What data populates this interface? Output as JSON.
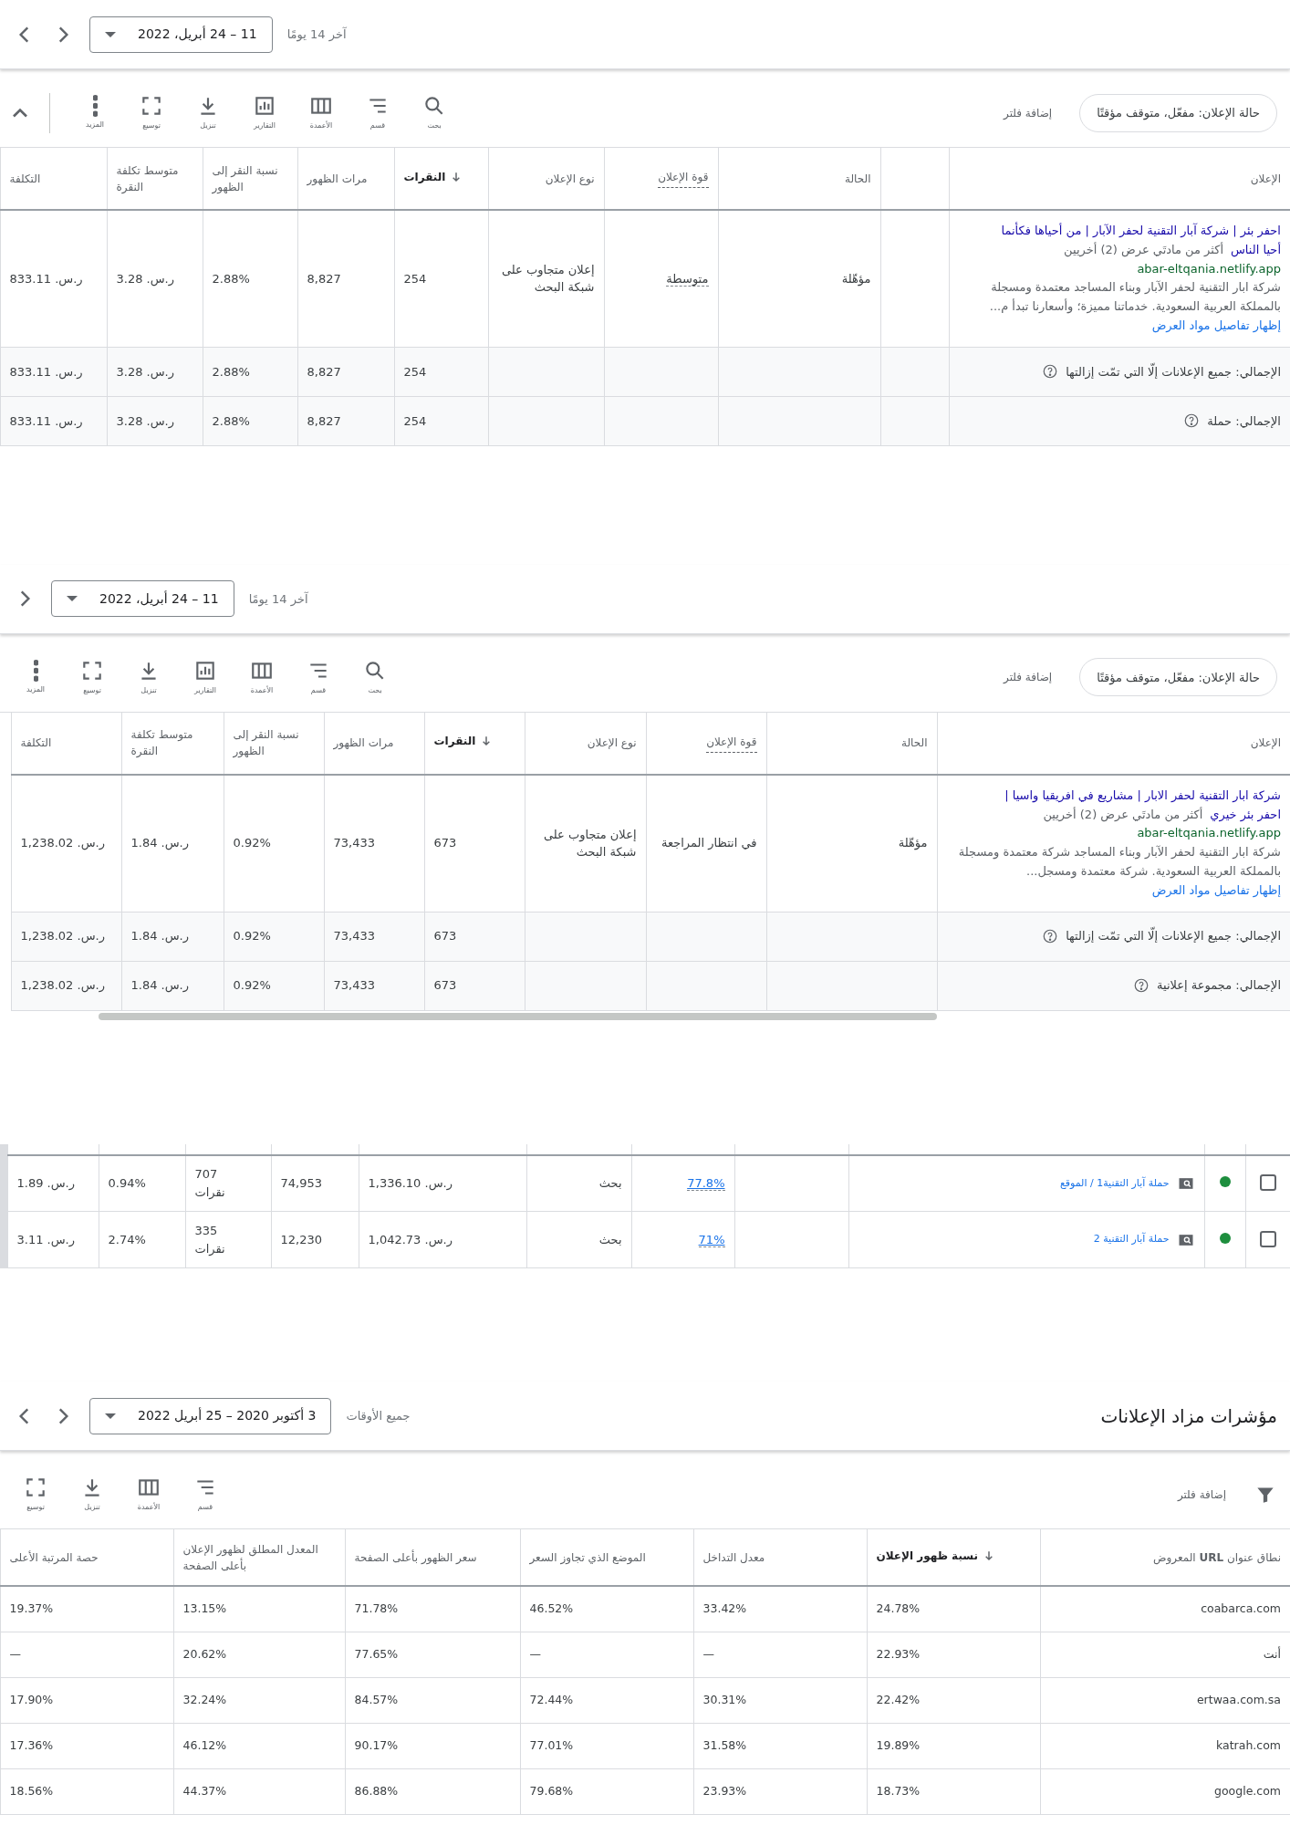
{
  "sections": [
    {
      "kind": "ads",
      "date_bar": {
        "range_label": "آخر 14 يومًا",
        "date": "11 – 24 أبريل، 2022",
        "arrows": [
          {
            "kind": "right"
          },
          {
            "kind": "left"
          }
        ]
      },
      "toolbar": {
        "filter_chip": "حالة الإعلان: مفعّل، متوقف مؤقتًا",
        "add_filter": "إضافة فلتر",
        "tools": [
          {
            "kind": "search",
            "label": "بحث"
          },
          {
            "kind": "segment",
            "label": "قسم"
          },
          {
            "kind": "columns",
            "label": "الأعمدة"
          },
          {
            "kind": "reports",
            "label": "التقارير"
          },
          {
            "kind": "download",
            "label": "تنزيل"
          },
          {
            "kind": "expand",
            "label": "توسيع"
          },
          {
            "kind": "more",
            "label": "المزيد"
          }
        ],
        "collapse": true
      },
      "table": {
        "columns": [
          {
            "label": "الإعلان",
            "sorted": false,
            "dotted": false
          },
          {
            "sorted": false,
            "dotted": false
          },
          {
            "label": "الحالة",
            "sorted": false,
            "dotted": false
          },
          {
            "label": "قوة الإعلان",
            "sorted": false,
            "dotted": true
          },
          {
            "label": "نوع الإعلان",
            "sorted": false,
            "dotted": false
          },
          {
            "label": "النقرات",
            "sorted": true,
            "dotted": false
          },
          {
            "label": "مرات الظهور",
            "sorted": false,
            "dotted": false
          },
          {
            "label": "نسبة النقر إلى الظهور",
            "sorted": false,
            "dotted": false
          },
          {
            "label": "متوسط تكلفة النقرة",
            "sorted": false,
            "dotted": false
          },
          {
            "label": "التكلفة",
            "sorted": false,
            "dotted": false
          }
        ],
        "rows": [
          {
            "cells": [
              {
                "kind": "ad",
                "headline": "احفر بئر | شركة آبار التقنية لحفر الآبار | من أحياها فكأنما",
                "headline_2": "أحيا الناس",
                "more": "أكثر من مادتَي عرض (2) أخريين",
                "url": "abar-eltqania.netlify.app",
                "description": "شركة ابار التقنية لحفر الآبار وبناء المساجد معتمدة ومسجلة بالمملكة العربية السعودية. خدماتنا مميزة؛ وأسعارنا تبدأ م...",
                "details_link": "إظهار تفاصيل مواد العرض"
              },
              "",
              "مؤهّلة",
              {
                "text": "متوسطة",
                "kind": "dotted"
              },
              "إعلان متجاوب على شبكة البحث",
              "254",
              "8,827",
              "2.88%",
              "ر.س. 3.28",
              "ر.س. 833.11"
            ]
          },
          {
            "cells": [
              {
                "kind": "total",
                "text": "الإجمالي: جميع الإعلانات إلّا التي تمّت إزالتها"
              },
              "",
              "",
              "",
              "",
              "254",
              "8,827",
              "2.88%",
              "ر.س. 3.28",
              "ر.س. 833.11"
            ]
          },
          {
            "cells": [
              {
                "kind": "total",
                "text": "الإجمالي: حملة"
              },
              "",
              "",
              "",
              "",
              "254",
              "8,827",
              "2.88%",
              "ر.س. 3.28",
              "ر.س. 833.11"
            ]
          }
        ]
      }
    },
    {
      "kind": "ads",
      "date_bar": {
        "range_label": "آخر 14 يومًا",
        "date": "11 – 24 أبريل، 2022",
        "arrows": [
          {
            "kind": "right"
          }
        ]
      },
      "toolbar": {
        "filter_chip": "حالة الإعلان: مفعّل، متوقف مؤقتًا",
        "add_filter": "إضافة فلتر",
        "tools": [
          {
            "kind": "search",
            "label": "بحث"
          },
          {
            "kind": "segment",
            "label": "قسم"
          },
          {
            "kind": "columns",
            "label": "الأعمدة"
          },
          {
            "kind": "reports",
            "label": "التقارير"
          },
          {
            "kind": "download",
            "label": "تنزيل"
          },
          {
            "kind": "expand",
            "label": "توسيع"
          },
          {
            "kind": "more",
            "label": "المزيد"
          }
        ],
        "collapse": false
      },
      "table": {
        "scrollbar": true,
        "columns": [
          {
            "label": "الإعلان",
            "sorted": false,
            "dotted": false
          },
          {
            "label": "الحالة",
            "sorted": false,
            "dotted": false
          },
          {
            "label": "قوة الإعلان",
            "sorted": false,
            "dotted": true
          },
          {
            "label": "نوع الإعلان",
            "sorted": false,
            "dotted": false
          },
          {
            "label": "النقرات",
            "sorted": true,
            "dotted": false
          },
          {
            "label": "مرات الظهور",
            "sorted": false,
            "dotted": false
          },
          {
            "label": "نسبة النقر إلى الظهور",
            "sorted": false,
            "dotted": false
          },
          {
            "label": "متوسط تكلفة النقرة",
            "sorted": false,
            "dotted": false
          },
          {
            "label": "التكلفة",
            "sorted": false,
            "dotted": false
          }
        ],
        "rows": [
          {
            "cells": [
              {
                "kind": "ad",
                "headline": "شركة ابار التقنية لحفر الابار | مشاريع في افريقيا واسيا |",
                "headline_2": "احفر بئر خيري",
                "more": "أكثر من مادتَي عرض (2) أخريين",
                "url": "abar-eltqania.netlify.app",
                "description": "شركة ابار التقنية لحفر الآبار وبناء المساجد شركة معتمدة ومسجلة بالمملكة العربية السعودية. شركة معتمدة ومسجل...",
                "details_link": "إظهار تفاصيل مواد العرض"
              },
              "مؤهّلة",
              "في انتظار المراجعة",
              "إعلان متجاوب على شبكة البحث",
              "673",
              "73,433",
              "0.92%",
              "ر.س. 1.84",
              "ر.س. 1,238.02"
            ]
          },
          {
            "cells": [
              {
                "kind": "total",
                "text": "الإجمالي: جميع الإعلانات إلّا التي تمّت إزالتها"
              },
              "",
              "",
              "",
              "673",
              "73,433",
              "0.92%",
              "ر.س. 1.84",
              "ر.س. 1,238.02"
            ]
          },
          {
            "cells": [
              {
                "kind": "total",
                "text": "الإجمالي: مجموعة إعلانية"
              },
              "",
              "",
              "",
              "673",
              "73,433",
              "0.92%",
              "ر.س. 1.84",
              "ر.س. 1,238.02"
            ]
          }
        ]
      }
    },
    {
      "kind": "campaigns",
      "table": {
        "rows": [
          {
            "checked": false,
            "color": "#1e8e3e",
            "campaign": "حملة آبار التقنية1 / الموقع",
            "cells": [
              "",
              {
                "text": "77.8%",
                "kind": "dotted-link"
              },
              "بحث",
              "ر.س. 1,336.10",
              "74,953",
              {
                "text": "707",
                "sub": "نقرات"
              },
              "0.94%",
              "ر.س. 1.89"
            ]
          },
          {
            "checked": false,
            "color": "#1e8e3e",
            "campaign": "حملة آبار التقنية 2",
            "cells": [
              "",
              {
                "text": "71%",
                "kind": "dotted-link"
              },
              "بحث",
              "ر.س. 1,042.73",
              "12,230",
              {
                "text": "335",
                "sub": "نقرات"
              },
              "2.74%",
              "ر.س. 3.11"
            ]
          }
        ]
      }
    },
    {
      "kind": "auction",
      "date_bar": {
        "title": "مؤشرات مزاد الإعلانات",
        "range_label": "جميع الأوقات",
        "date": "3 أكتوبر 2020 – 25 أبريل 2022",
        "arrows": [
          {
            "kind": "right"
          },
          {
            "kind": "left"
          }
        ]
      },
      "toolbar": {
        "filter_icon": true,
        "add_filter": "إضافة فلتر",
        "tools": [
          {
            "kind": "segment",
            "label": "قسم"
          },
          {
            "kind": "columns",
            "label": "الأعمدة"
          },
          {
            "kind": "download",
            "label": "تنزيل"
          },
          {
            "kind": "expand",
            "label": "توسيع"
          }
        ],
        "collapse": false
      },
      "table": {
        "columns": [
          {
            "label": "نطاق عنوان **URL** المعروض",
            "sorted": false,
            "dotted": false
          },
          {
            "label": "نسبة ظهور الإعلان",
            "sorted": true,
            "dotted": false
          },
          {
            "label": "معدل التداخل",
            "sorted": false,
            "dotted": false
          },
          {
            "label": "الموضع الذي تجاوز السعر",
            "sorted": false,
            "dotted": false
          },
          {
            "label": "سعر الظهور بأعلى الصفحة",
            "sorted": false,
            "dotted": false
          },
          {
            "label": "المعدل المطلق لظهور الإعلان بأعلى الصفحة",
            "sorted": false,
            "dotted": false
          },
          {
            "label": "حصة المرتبة الأعلى",
            "sorted": false,
            "dotted": false
          }
        ],
        "rows": [
          {
            "cells": [
              "coabarca.com",
              "24.78%",
              "33.42%",
              "46.52%",
              "71.78%",
              "13.15%",
              "19.37%"
            ]
          },
          {
            "cells": [
              "أنت",
              "22.93%",
              "—",
              "—",
              "77.65%",
              "20.62%",
              "—"
            ]
          },
          {
            "cells": [
              "ertwaa.com.sa",
              "22.42%",
              "30.31%",
              "72.44%",
              "84.57%",
              "32.24%",
              "17.90%"
            ]
          },
          {
            "cells": [
              "katrah.com",
              "19.89%",
              "31.58%",
              "77.01%",
              "90.17%",
              "46.12%",
              "17.36%"
            ]
          },
          {
            "cells": [
              "google.com",
              "18.73%",
              "23.93%",
              "79.68%",
              "86.88%",
              "44.37%",
              "18.56%"
            ]
          }
        ]
      }
    }
  ]
}
